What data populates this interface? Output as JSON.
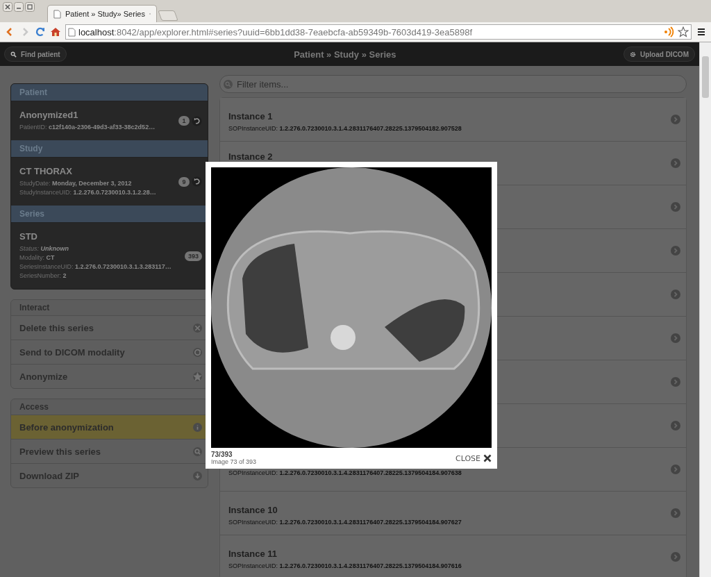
{
  "browser": {
    "tab_title": "Patient » Study» Series",
    "url_host": "localhost",
    "url_rest": ":8042/app/explorer.html#series?uuid=6bb1dd38-7eaebcfa-ab59349b-7603d419-3ea5898f"
  },
  "header": {
    "find_button": "Find patient",
    "title": "Patient » Study » Series",
    "upload_button": "Upload DICOM"
  },
  "sidebar": {
    "sections": [
      {
        "header": "Patient",
        "title": "Anonymized1",
        "count": "1",
        "fields": [
          {
            "kind": "plain",
            "label": "PatientID:",
            "value": "c12f140a-2306-49d3-af33-38c2d52…"
          }
        ]
      },
      {
        "header": "Study",
        "title": "CT THORAX",
        "count": "9",
        "fields": [
          {
            "kind": "plain",
            "label": "StudyDate:",
            "value": "Monday, December 3, 2012"
          },
          {
            "kind": "plain",
            "label": "StudyInstanceUID:",
            "value": "1.2.276.0.7230010.3.1.2.28…"
          }
        ]
      },
      {
        "header": "Series",
        "title": "STD",
        "count": "393",
        "fields": [
          {
            "kind": "status",
            "label": "Status:",
            "value": "Unknown"
          },
          {
            "kind": "plain",
            "label": "Modality:",
            "value": "CT"
          },
          {
            "kind": "plain",
            "label": "SeriesInstanceUID:",
            "value": "1.2.276.0.7230010.3.1.3.283117…"
          },
          {
            "kind": "plain",
            "label": "SeriesNumber:",
            "value": "2"
          }
        ]
      }
    ],
    "interact": {
      "header": "Interact",
      "items": [
        {
          "label": "Delete this series",
          "kind": "delete"
        },
        {
          "label": "Send to DICOM modality",
          "kind": "send"
        },
        {
          "label": "Anonymize",
          "kind": "star"
        }
      ]
    },
    "access": {
      "header": "Access",
      "items": [
        {
          "label": "Before anonymization",
          "kind": "info",
          "selected": true
        },
        {
          "label": "Preview this series",
          "kind": "search",
          "selected": false
        },
        {
          "label": "Download ZIP",
          "kind": "download",
          "selected": false
        }
      ]
    }
  },
  "filter": {
    "placeholder": "Filter items..."
  },
  "instances": [
    {
      "kind": "full",
      "title": "Instance 1",
      "uid_label": "SOPInstanceUID:",
      "uid": "1.2.276.0.7230010.3.1.4.2831176407.28225.1379504182.907528"
    },
    {
      "kind": "title_only",
      "title": "Instance 2"
    },
    {
      "kind": "covered"
    },
    {
      "kind": "covered"
    },
    {
      "kind": "covered"
    },
    {
      "kind": "covered"
    },
    {
      "kind": "covered"
    },
    {
      "kind": "covered"
    },
    {
      "kind": "full",
      "uid_label": "SOPInstanceUID:",
      "uid": "1.2.276.0.7230010.3.1.4.2831176407.28225.1379504184.907638"
    },
    {
      "kind": "full",
      "title": "Instance 10",
      "uid_label": "SOPInstanceUID:",
      "uid": "1.2.276.0.7230010.3.1.4.2831176407.28225.1379504184.907627"
    },
    {
      "kind": "full",
      "title": "Instance 11",
      "uid_label": "SOPInstanceUID:",
      "uid": "1.2.276.0.7230010.3.1.4.2831176407.28225.1379504184.907616"
    }
  ],
  "lightbox": {
    "counter": "73/393",
    "caption": "Image 73 of 393",
    "close": "CLOSE"
  }
}
